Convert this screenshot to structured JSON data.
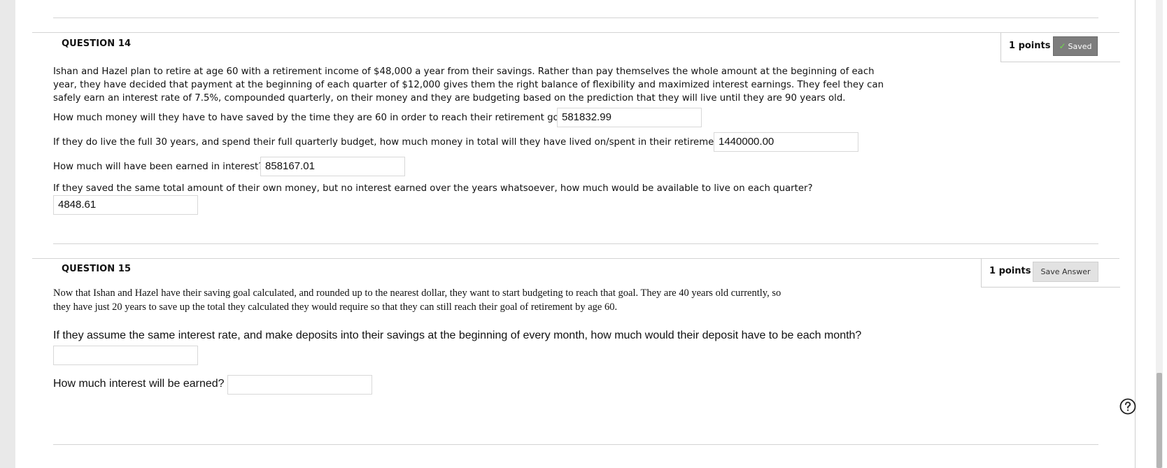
{
  "questions": [
    {
      "title": "QUESTION 14",
      "points": "1 points",
      "save_status": "Saved",
      "intro": "Ishan and Hazel plan to retire at age 60 with a retirement income of $48,000 a year from their savings.  Rather than pay themselves the whole amount at the beginning of each year, they have decided that payment at the beginning of each quarter of $12,000 gives them the right balance of flexibility and maximized interest earnings.  They feel they can safely earn an interest rate of 7.5%, compounded quarterly, on their money and they are budgeting based on the prediction that they will live until they are 90 years old.",
      "intro_lines": [
        "Ishan and Hazel plan to retire at age 60 with a retirement income of $48,000 a year from their savings.  Rather than pay themselves the whole amount at the beginning of each",
        "year, they have decided that payment at the beginning of each quarter of $12,000 gives them the right balance of flexibility and maximized interest earnings.  They feel they can",
        "safely earn an interest rate of 7.5%, compounded quarterly, on their money and they are budgeting based on the prediction that they will live until they are 90 years old."
      ],
      "parts": [
        {
          "prompt": "How much money will they have to have saved by the time they are 60 in order to reach their retirement goal?",
          "value": "581832.99"
        },
        {
          "prompt": "If they do live the full 30 years, and spend their full quarterly budget, how much money in total will they have lived on/spent in  their retirement?",
          "value": "1440000.00"
        },
        {
          "prompt": "How much will have been earned in interest?",
          "value": "858167.01"
        },
        {
          "prompt": "If they saved the same total amount of their own money, but no interest earned over the years whatsoever, how much would be available to live on each quarter?",
          "value": "4848.61"
        }
      ]
    },
    {
      "title": "QUESTION 15",
      "points": "1 points",
      "save_status": "Save Answer",
      "intro_lines": [
        "Now that Ishan and Hazel have their saving goal calculated, and rounded up to the nearest dollar, they want to start budgeting to reach that goal.  They are 40 years old currently, so",
        "they have just 20 years to save up the total they calculated they would require so that they can still reach their goal of retirement by age 60."
      ],
      "parts": [
        {
          "prompt": "If they assume the same interest rate, and make deposits into their savings at the beginning of every month, how much would their deposit have to be each month?",
          "value": ""
        },
        {
          "prompt": "How much interest will be earned?",
          "value": ""
        }
      ]
    }
  ],
  "icons": {
    "saved_check": "checkmark-icon",
    "help": "help-circle-icon"
  },
  "colors": {
    "saved_button_bg": "#7d7d7d",
    "save_button_bg": "#e2e2e2",
    "check": "#6fdc4a"
  }
}
